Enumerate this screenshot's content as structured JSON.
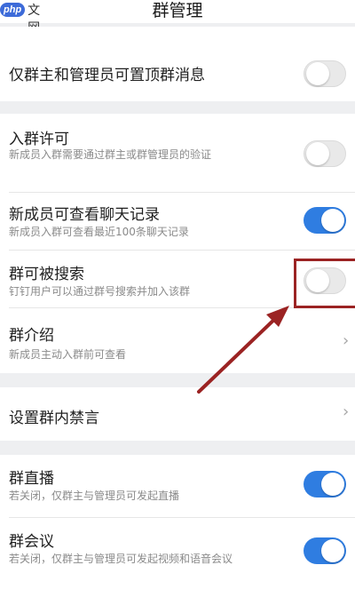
{
  "header": {
    "watermark_logo": "php",
    "watermark_text": "中文网",
    "title": "群管理"
  },
  "rows": {
    "pin": {
      "title": "仅群主和管理员可置顶群消息",
      "enabled": false
    },
    "join_permission": {
      "title": "入群许可",
      "subtitle": "新成员入群需要通过群主或群管理员的验证",
      "enabled": false
    },
    "view_history": {
      "title": "新成员可查看聊天记录",
      "subtitle": "新成员入群可查看最近100条聊天记录",
      "enabled": true
    },
    "searchable": {
      "title": "群可被搜索",
      "subtitle": "钉钉用户可以通过群号搜索并加入该群",
      "enabled": false
    },
    "intro": {
      "title": "群介绍",
      "subtitle": "新成员主动入群前可查看"
    },
    "mute": {
      "title": "设置群内禁言"
    },
    "live": {
      "title": "群直播",
      "subtitle": "若关闭，仅群主与管理员可发起直播",
      "enabled": true
    },
    "meeting": {
      "title": "群会议",
      "subtitle": "若关闭，仅群主与管理员可发起视频和语音会议",
      "enabled": true
    }
  },
  "icons": {
    "chevron": "›"
  },
  "colors": {
    "toggle_on": "#2f7de1",
    "highlight": "#9b2323",
    "background": "#eeeff1"
  }
}
